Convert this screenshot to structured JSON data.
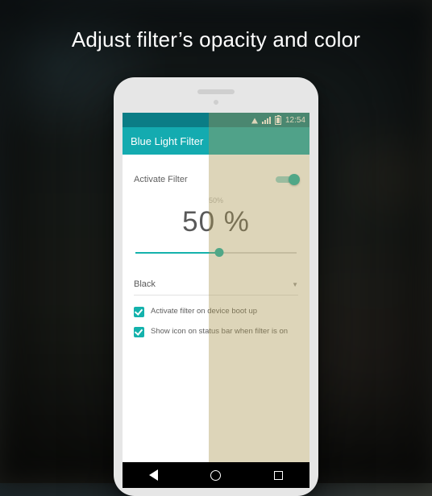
{
  "headline": "Adjust filter’s opacity and color",
  "statusbar": {
    "time": "12:54"
  },
  "appbar": {
    "title": "Blue Light Filter"
  },
  "activate": {
    "label": "Activate Filter",
    "on": true
  },
  "opacity": {
    "small_label": "50%",
    "big_label": "50 %",
    "value": 50
  },
  "color_select": {
    "value": "Black"
  },
  "options": {
    "boot": {
      "label": "Activate filter on device boot up",
      "checked": true
    },
    "statusbar_icon": {
      "label": "Show icon on status bar when filter is on",
      "checked": true
    }
  },
  "colors": {
    "accent": "#14b2ac",
    "appbar": "#14abb0",
    "status": "#0b7d86"
  }
}
